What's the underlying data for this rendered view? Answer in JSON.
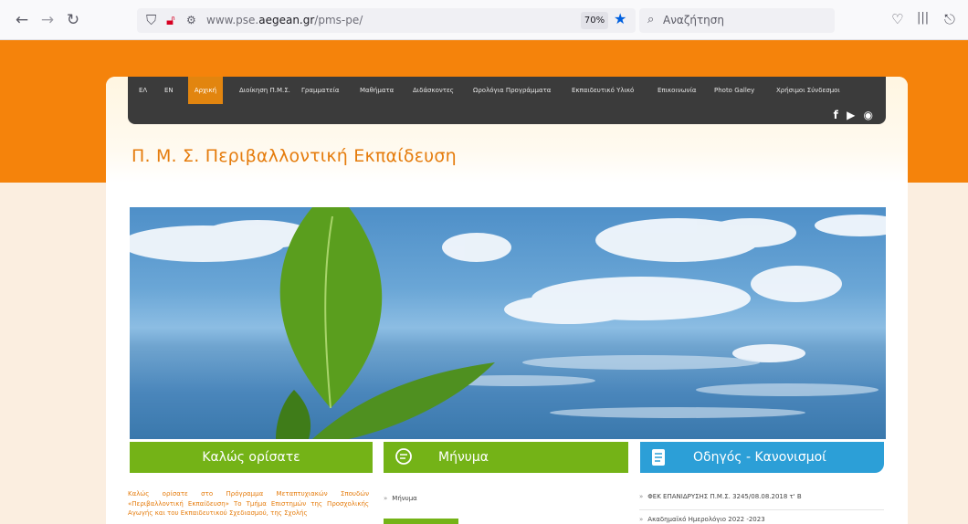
{
  "browser": {
    "url_prefix": "www.pse.",
    "url_domain": "aegean.gr",
    "url_path": "/pms-pe/",
    "zoom": "70%",
    "search_placeholder": "Αναζήτηση"
  },
  "menu": {
    "items": [
      {
        "label": "ΕΛ"
      },
      {
        "label": "EN"
      },
      {
        "label": "Αρχική"
      },
      {
        "label": "Διοίκηση Π.Μ.Σ."
      },
      {
        "label": "Γραμματεία"
      },
      {
        "label": "Μαθήματα"
      },
      {
        "label": "Διδάσκοντες"
      },
      {
        "label": "Ωρολόγια Προγράμματα"
      },
      {
        "label": "Εκπαιδευτικό Υλικό"
      },
      {
        "label": "Επικοινωνία"
      },
      {
        "label": "Photo Galley"
      },
      {
        "label": "Χρήσιμοι Σύνδεσμοι"
      }
    ],
    "active": "Αρχική",
    "social": [
      "f",
      "▶",
      "RSS"
    ]
  },
  "site": {
    "title": "Π. Μ. Σ. Περιβαλλοντική Εκπαίδευση"
  },
  "columns": {
    "welcome_title": "Καλώς ορίσατε",
    "message_title": "Μήνυμα",
    "guide_title": "Οδηγός - Κανονισμοί",
    "welcome_text": "Καλώς ορίσατε στο Πρόγραμμα Μεταπτυχιακών Σπουδών «Περιβαλλοντική Εκπαίδευση» Το Τμήμα Επιστημών της Προσχολικής Αγωγής και του Εκπαιδευτικού Σχεδιασμού, της Σχολής",
    "message_links": [
      "Μήνυμα"
    ],
    "guide_links": [
      "ΦΕΚ ΕΠΑΝΙΔΡΥΣΗΣ Π.Μ.Σ. 3245/08.08.2018 τ' Β",
      "Ακαδημαϊκό Ημερολόγιο 2022 -2023"
    ]
  },
  "colors": {
    "orange": "#f5830b",
    "menu_bg": "#3b3b3b",
    "green": "#74b317",
    "blue": "#2c9fd7"
  }
}
